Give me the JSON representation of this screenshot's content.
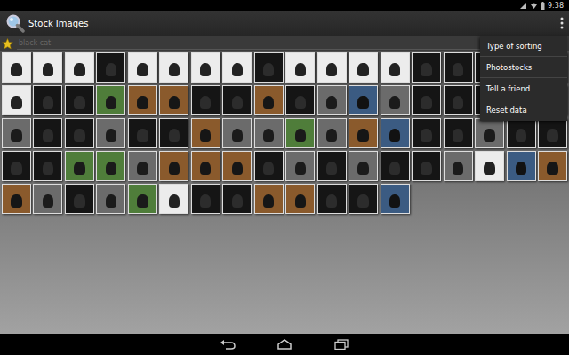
{
  "status_bar": {
    "time": "9:38"
  },
  "action_bar": {
    "title": "Stock Images"
  },
  "search": {
    "value": "black cat"
  },
  "menu": {
    "items": [
      {
        "label": "Type of sorting"
      },
      {
        "label": "Photostocks"
      },
      {
        "label": "Tell a friend"
      },
      {
        "label": "Reset data"
      }
    ]
  },
  "thumbnails": [
    {
      "kind": "light"
    },
    {
      "kind": "light"
    },
    {
      "kind": "light"
    },
    {
      "kind": "dark"
    },
    {
      "kind": "light"
    },
    {
      "kind": "light"
    },
    {
      "kind": "light"
    },
    {
      "kind": "light"
    },
    {
      "kind": "dark"
    },
    {
      "kind": "light"
    },
    {
      "kind": "light"
    },
    {
      "kind": "light"
    },
    {
      "kind": "light"
    },
    {
      "kind": "dark"
    },
    {
      "kind": "dark"
    },
    {
      "kind": "dark"
    },
    {
      "kind": "dark"
    },
    {
      "kind": "dark"
    },
    {
      "kind": "light"
    },
    {
      "kind": "dark"
    },
    {
      "kind": "dark"
    },
    {
      "kind": "green"
    },
    {
      "kind": "warm"
    },
    {
      "kind": "warm"
    },
    {
      "kind": "dark"
    },
    {
      "kind": "dark"
    },
    {
      "kind": "warm"
    },
    {
      "kind": "dark"
    },
    {
      "kind": "grey"
    },
    {
      "kind": "blue"
    },
    {
      "kind": "grey"
    },
    {
      "kind": "dark"
    },
    {
      "kind": "dark"
    },
    {
      "kind": "dark"
    },
    {
      "kind": "dark"
    },
    {
      "kind": "dark"
    },
    {
      "kind": "grey"
    },
    {
      "kind": "dark"
    },
    {
      "kind": "dark"
    },
    {
      "kind": "grey"
    },
    {
      "kind": "dark"
    },
    {
      "kind": "dark"
    },
    {
      "kind": "warm"
    },
    {
      "kind": "grey"
    },
    {
      "kind": "grey"
    },
    {
      "kind": "green"
    },
    {
      "kind": "grey"
    },
    {
      "kind": "warm"
    },
    {
      "kind": "blue"
    },
    {
      "kind": "dark"
    },
    {
      "kind": "dark"
    },
    {
      "kind": "grey"
    },
    {
      "kind": "dark"
    },
    {
      "kind": "dark"
    },
    {
      "kind": "dark"
    },
    {
      "kind": "dark"
    },
    {
      "kind": "green"
    },
    {
      "kind": "green"
    },
    {
      "kind": "grey"
    },
    {
      "kind": "warm"
    },
    {
      "kind": "warm"
    },
    {
      "kind": "warm"
    },
    {
      "kind": "dark"
    },
    {
      "kind": "grey"
    },
    {
      "kind": "dark"
    },
    {
      "kind": "grey"
    },
    {
      "kind": "dark"
    },
    {
      "kind": "dark"
    },
    {
      "kind": "grey"
    },
    {
      "kind": "light"
    },
    {
      "kind": "blue"
    },
    {
      "kind": "warm"
    },
    {
      "kind": "warm"
    },
    {
      "kind": "grey"
    },
    {
      "kind": "dark"
    },
    {
      "kind": "grey"
    },
    {
      "kind": "green"
    },
    {
      "kind": "light"
    },
    {
      "kind": "dark"
    },
    {
      "kind": "dark"
    },
    {
      "kind": "warm"
    },
    {
      "kind": "warm"
    },
    {
      "kind": "dark"
    },
    {
      "kind": "dark"
    },
    {
      "kind": "blue"
    }
  ]
}
